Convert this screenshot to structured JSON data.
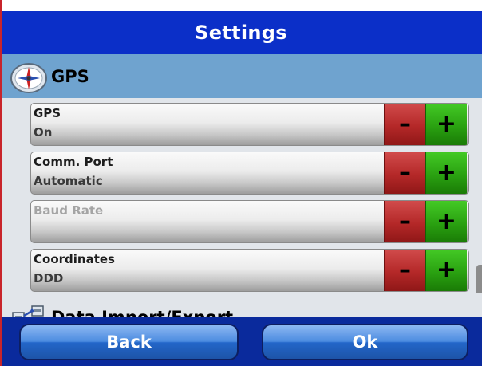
{
  "screen": {
    "title": "Settings"
  },
  "gps_section": {
    "title": "GPS",
    "icon": "compass-icon"
  },
  "settings": [
    {
      "label": "GPS",
      "value": "On",
      "enabled": true
    },
    {
      "label": "Comm. Port",
      "value": "Automatic",
      "enabled": true
    },
    {
      "label": "Baud Rate",
      "value": "",
      "enabled": false
    },
    {
      "label": "Coordinates",
      "value": "DDD",
      "enabled": true
    }
  ],
  "stepper": {
    "minus_symbol": "–",
    "plus_symbol": "+"
  },
  "next_section": {
    "title": "Data Import/Export",
    "icon": "data-transfer-icon"
  },
  "footer": {
    "back_label": "Back",
    "ok_label": "Ok"
  },
  "colors": {
    "title_bar": "#0b2fc8",
    "section_header": "#6fa3cf",
    "minus_button": "#b42828",
    "plus_button": "#2aa111",
    "footer_bar": "#0a2a9c"
  }
}
